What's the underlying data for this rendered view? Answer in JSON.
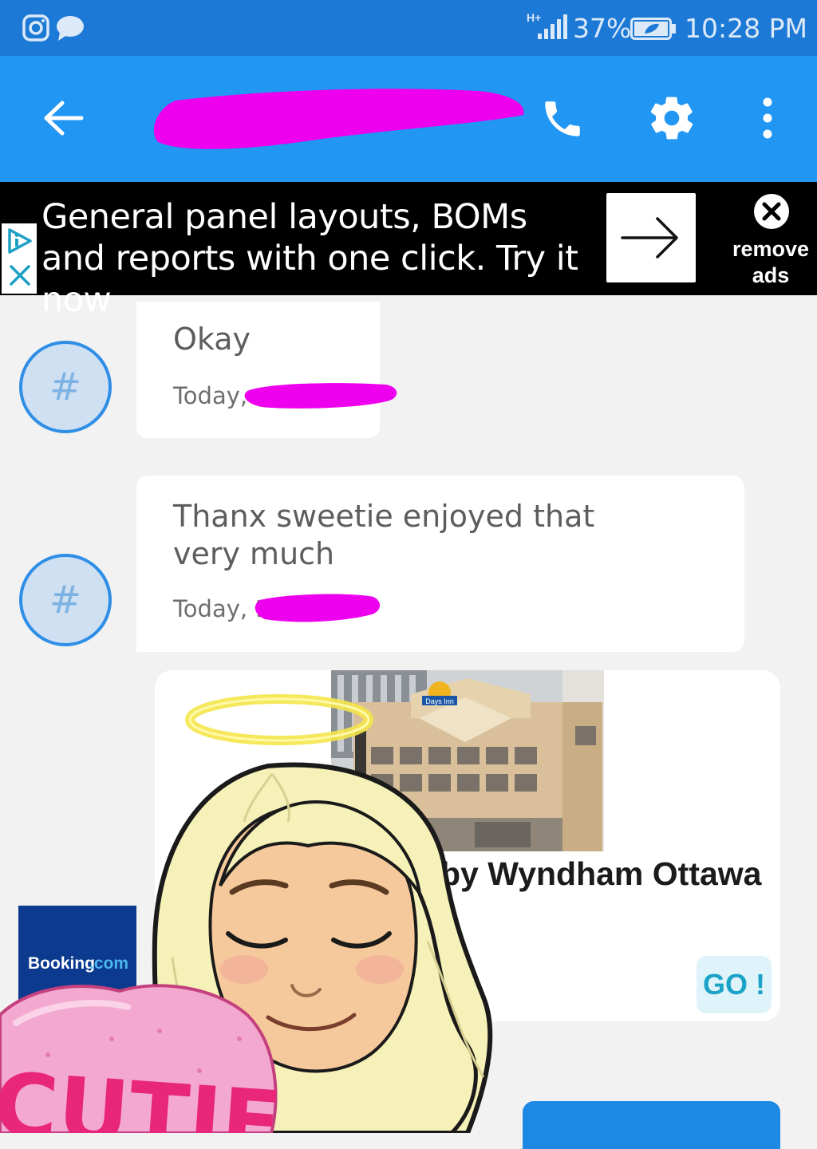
{
  "status_bar": {
    "network": "H+",
    "battery_percent": "37%",
    "time": "10:28 PM",
    "icons": [
      "instagram-icon",
      "chat-bubble-icon",
      "signal-icon",
      "battery-saver-icon"
    ]
  },
  "app_bar": {
    "title": "",
    "icons": [
      "back-arrow-icon",
      "phone-icon",
      "gear-icon",
      "overflow-menu-icon"
    ]
  },
  "ad_banner": {
    "text": "General panel layouts, BOMs and reports with one click. Try it now",
    "remove_label": "remove ads",
    "icons": [
      "adchoices-icon",
      "ad-close-icon",
      "arrow-right-icon",
      "close-circle-icon"
    ]
  },
  "messages": [
    {
      "text": "Okay",
      "time": "Today, ",
      "avatar": "#"
    },
    {
      "text": "Thanx sweetie enjoyed that very much",
      "time": "Today, 1",
      "avatar": "#"
    }
  ],
  "card": {
    "hotel_caption": "by Wyndham Ottawa",
    "sign_text": "Days Inn",
    "go_label": "GO !",
    "booking_brand": "Booking",
    "booking_tld": ".com",
    "sticker_text": "CUTIE"
  },
  "colors": {
    "status_bar": "#1c79d6",
    "app_bar": "#2196f3",
    "ad_background": "#000000",
    "redaction": "#ee00ee",
    "avatar_ring": "#2f8ee6",
    "go_text": "#1aa3c7"
  }
}
